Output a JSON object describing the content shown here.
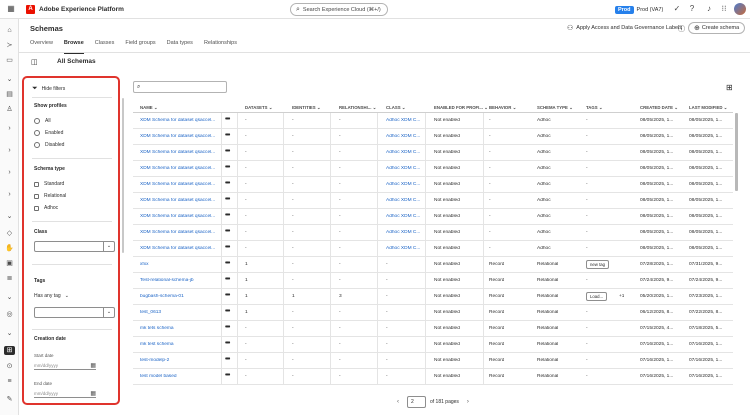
{
  "app": {
    "name": "Adobe Experience Platform",
    "logo_glyph": "A",
    "accent": "#eb1000"
  },
  "global_search": {
    "placeholder": "Search Experience Cloud (⌘+/)"
  },
  "sandbox": {
    "badge": "Prod",
    "name": "Prod (VA7)"
  },
  "page": {
    "title": "Schemas",
    "governance_action": "Apply Access and Data Governance Labels",
    "create_button": "Create schema",
    "tabs": [
      {
        "label": "Overview",
        "selected": false
      },
      {
        "label": "Browse",
        "selected": true
      },
      {
        "label": "Classes",
        "selected": false
      },
      {
        "label": "Field groups",
        "selected": false
      },
      {
        "label": "Data types",
        "selected": false
      },
      {
        "label": "Relationships",
        "selected": false
      }
    ],
    "section_title": "All Schemas"
  },
  "filters": {
    "hide_label": "Hide filters",
    "show_profiles": {
      "label": "Show profiles",
      "options": [
        "All",
        "Enabled",
        "Disabled"
      ]
    },
    "schema_type": {
      "label": "Schema type",
      "options": [
        "Standard",
        "Relational",
        "Adhoc"
      ]
    },
    "class": {
      "label": "Class",
      "value": ""
    },
    "tags": {
      "label": "Tags",
      "mode": "Has any tag",
      "value": ""
    },
    "creation_date": {
      "label": "Creation date",
      "start_label": "Start date",
      "end_label": "End date",
      "placeholder": "mm/dd/yyyy"
    }
  },
  "table": {
    "search_value": "",
    "columns": [
      "NAME",
      "DATASETS",
      "IDENTITIES",
      "RELATIONSHI...",
      "CLASS",
      "ENABLED FOR PROFI...",
      "BEHAVIOR",
      "SCHEMA TYPE",
      "TAGS",
      "CREATED DATE",
      "LAST MODIFIED"
    ],
    "rows": [
      {
        "name": "XDM Schema for dataset qsaccel...",
        "datasets": "-",
        "identities": "-",
        "relationships": "-",
        "class": "Adhoc XDM C...",
        "profile": "Not enabled",
        "behavior": "-",
        "type": "Adhoc",
        "tags": "-",
        "created": "08/05/2025, 1...",
        "modified": "08/05/2025, 1..."
      },
      {
        "name": "XDM Schema for dataset qsaccel...",
        "datasets": "-",
        "identities": "-",
        "relationships": "-",
        "class": "Adhoc XDM C...",
        "profile": "Not enabled",
        "behavior": "-",
        "type": "Adhoc",
        "tags": "-",
        "created": "08/05/2025, 1...",
        "modified": "08/05/2025, 1..."
      },
      {
        "name": "XDM Schema for dataset qsaccel...",
        "datasets": "-",
        "identities": "-",
        "relationships": "-",
        "class": "Adhoc XDM C...",
        "profile": "Not enabled",
        "behavior": "-",
        "type": "Adhoc",
        "tags": "-",
        "created": "08/05/2025, 1...",
        "modified": "08/05/2025, 1..."
      },
      {
        "name": "XDM Schema for dataset qsaccel...",
        "datasets": "-",
        "identities": "-",
        "relationships": "-",
        "class": "Adhoc XDM C...",
        "profile": "Not enabled",
        "behavior": "-",
        "type": "Adhoc",
        "tags": "-",
        "created": "08/05/2025, 1...",
        "modified": "08/05/2025, 1..."
      },
      {
        "name": "XDM Schema for dataset qsaccel...",
        "datasets": "-",
        "identities": "-",
        "relationships": "-",
        "class": "Adhoc XDM C...",
        "profile": "Not enabled",
        "behavior": "-",
        "type": "Adhoc",
        "tags": "-",
        "created": "08/05/2025, 1...",
        "modified": "08/05/2025, 1..."
      },
      {
        "name": "XDM Schema for dataset qsaccel...",
        "datasets": "-",
        "identities": "-",
        "relationships": "-",
        "class": "Adhoc XDM C...",
        "profile": "Not enabled",
        "behavior": "-",
        "type": "Adhoc",
        "tags": "-",
        "created": "08/05/2025, 1...",
        "modified": "08/05/2025, 1..."
      },
      {
        "name": "XDM Schema for dataset qsaccel...",
        "datasets": "-",
        "identities": "-",
        "relationships": "-",
        "class": "Adhoc XDM C...",
        "profile": "Not enabled",
        "behavior": "-",
        "type": "Adhoc",
        "tags": "-",
        "created": "08/05/2025, 1...",
        "modified": "08/05/2025, 1..."
      },
      {
        "name": "XDM Schema for dataset qsaccel...",
        "datasets": "-",
        "identities": "-",
        "relationships": "-",
        "class": "Adhoc XDM C...",
        "profile": "Not enabled",
        "behavior": "-",
        "type": "Adhoc",
        "tags": "-",
        "created": "08/05/2025, 1...",
        "modified": "08/05/2025, 1..."
      },
      {
        "name": "XDM Schema for dataset qsaccel...",
        "datasets": "-",
        "identities": "-",
        "relationships": "-",
        "class": "Adhoc XDM C...",
        "profile": "Not enabled",
        "behavior": "-",
        "type": "Adhoc",
        "tags": "-",
        "created": "08/05/2025, 1...",
        "modified": "08/05/2025, 1..."
      },
      {
        "name": "xfxx",
        "datasets": "1",
        "identities": "-",
        "relationships": "-",
        "class": "-",
        "profile": "Not enabled",
        "behavior": "Record",
        "type": "Relational",
        "tags": "new tag",
        "tags_extra": "",
        "created": "07/28/2025, 1...",
        "modified": "07/31/2025, 9..."
      },
      {
        "name": "Test-relational-schema-jb",
        "datasets": "1",
        "identities": "-",
        "relationships": "-",
        "class": "-",
        "profile": "Not enabled",
        "behavior": "Record",
        "type": "Relational",
        "tags": "-",
        "created": "07/24/2025, 9...",
        "modified": "07/24/2025, 9..."
      },
      {
        "name": "bugbash-schema-01",
        "datasets": "1",
        "identities": "1",
        "relationships": "3",
        "class": "-",
        "profile": "Not enabled",
        "behavior": "Record",
        "type": "Relational",
        "tags": "Load...",
        "tags_extra": "+1",
        "created": "05/20/2025, 1...",
        "modified": "07/23/2025, 1..."
      },
      {
        "name": "test_0613",
        "datasets": "1",
        "identities": "-",
        "relationships": "-",
        "class": "-",
        "profile": "Not enabled",
        "behavior": "Record",
        "type": "Relational",
        "tags": "-",
        "created": "06/12/2025, 8...",
        "modified": "07/22/2025, 8..."
      },
      {
        "name": "mk tets schema",
        "datasets": "-",
        "identities": "-",
        "relationships": "-",
        "class": "-",
        "profile": "Not enabled",
        "behavior": "Record",
        "type": "Relational",
        "tags": "-",
        "created": "07/15/2025, 4...",
        "modified": "07/18/2025, 5..."
      },
      {
        "name": "mk test schema",
        "datasets": "-",
        "identities": "-",
        "relationships": "-",
        "class": "-",
        "profile": "Not enabled",
        "behavior": "Record",
        "type": "Relational",
        "tags": "-",
        "created": "07/16/2025, 1...",
        "modified": "07/16/2025, 1..."
      },
      {
        "name": "test-modelp-2",
        "datasets": "-",
        "identities": "-",
        "relationships": "-",
        "class": "-",
        "profile": "Not enabled",
        "behavior": "Record",
        "type": "Relational",
        "tags": "-",
        "created": "07/16/2025, 1...",
        "modified": "07/16/2025, 1..."
      },
      {
        "name": "test model based",
        "datasets": "-",
        "identities": "-",
        "relationships": "-",
        "class": "-",
        "profile": "Not enabled",
        "behavior": "Record",
        "type": "Relational",
        "tags": "-",
        "created": "07/16/2025, 1...",
        "modified": "07/16/2025, 1..."
      }
    ]
  },
  "pagination": {
    "current": "2",
    "total_text": "of 181 pages"
  }
}
